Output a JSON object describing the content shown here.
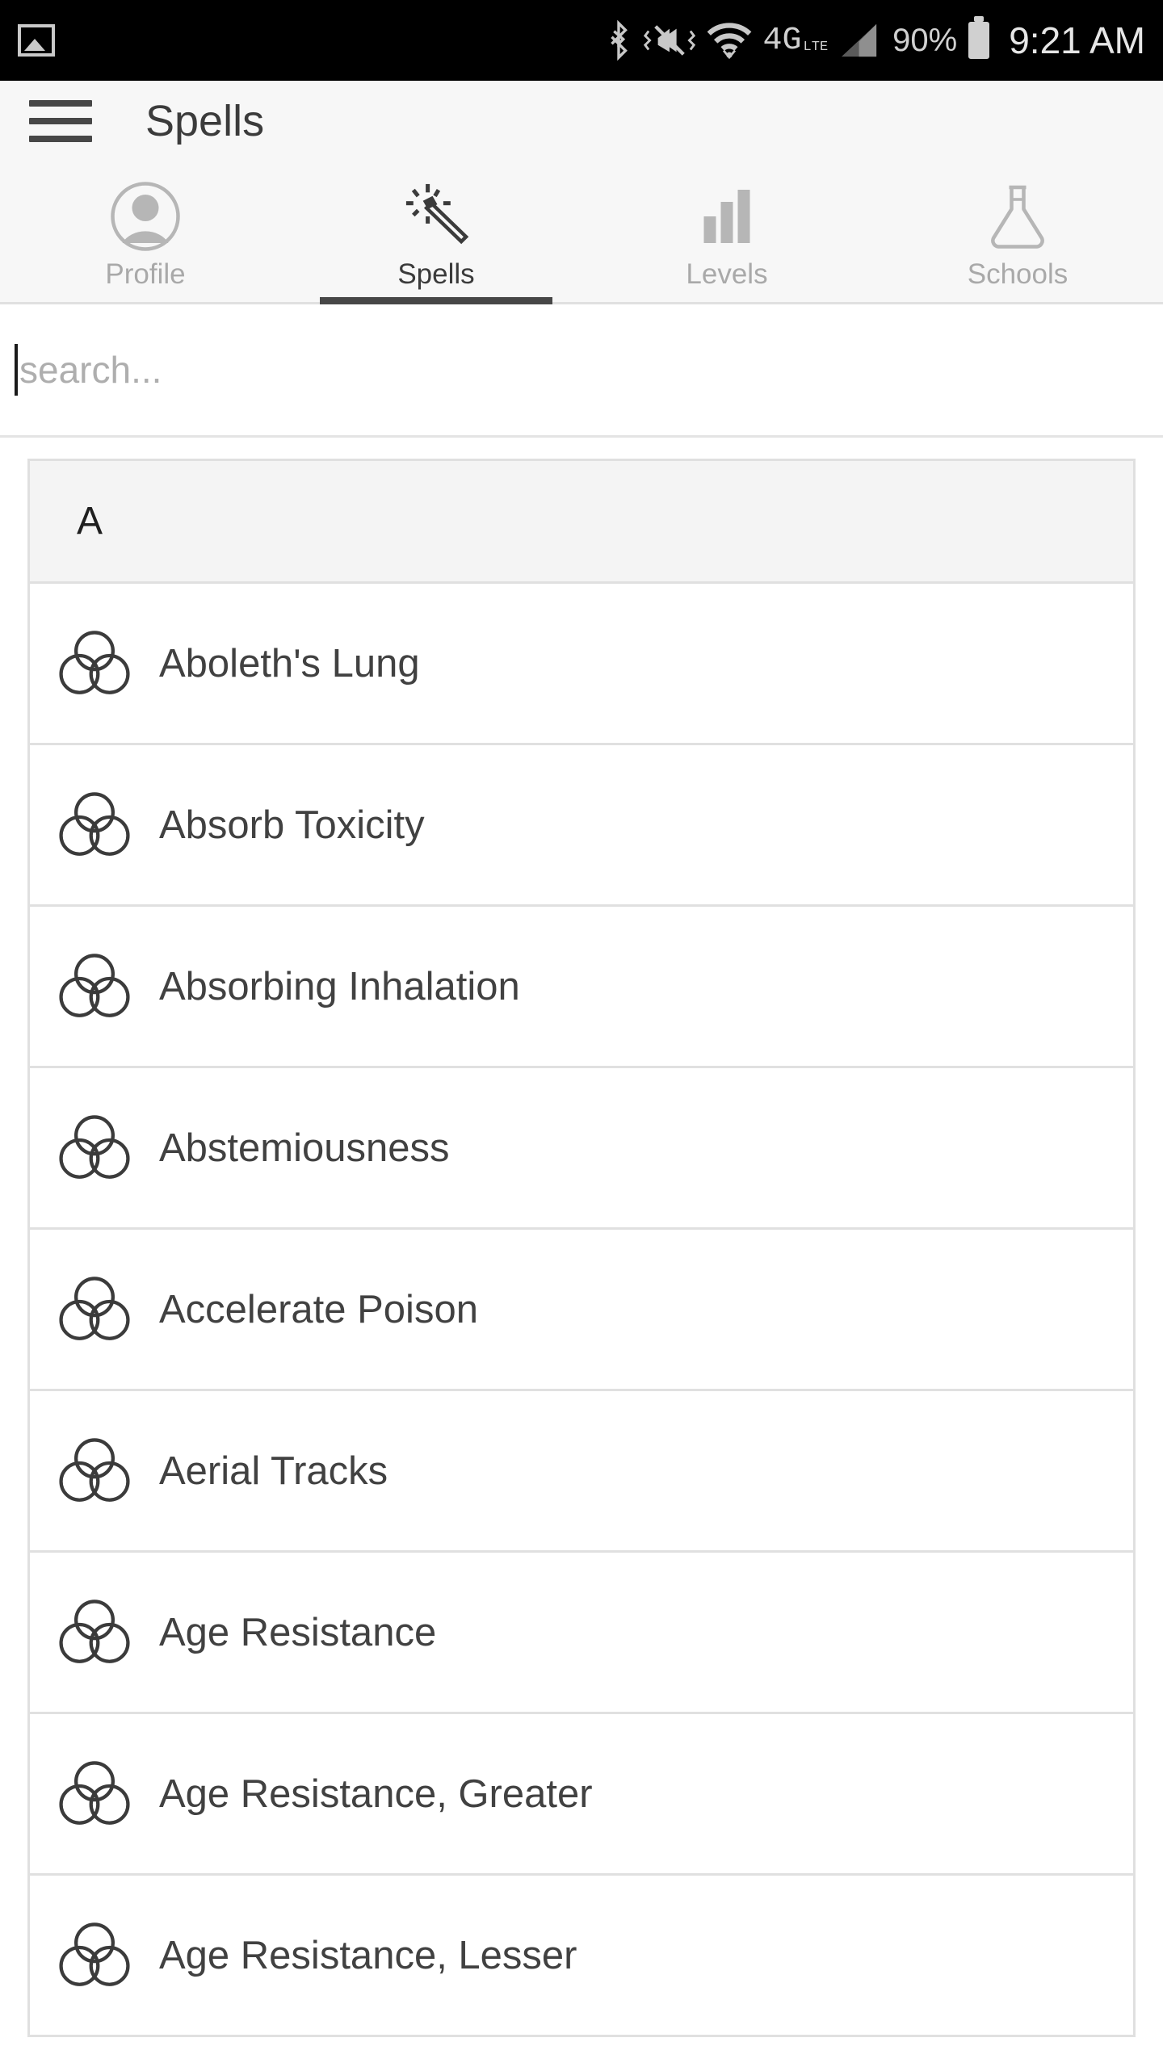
{
  "statusbar": {
    "gallery_icon": "gallery-icon",
    "bluetooth_icon": "bluetooth-icon",
    "vibrate_off_icon": "vibrate-off-icon",
    "wifi_icon": "wifi-icon",
    "network_type": "4G",
    "network_type_sub": "LTE",
    "signal_icon": "cellular-signal-icon",
    "battery_percent": "90%",
    "battery_icon": "battery-icon",
    "clock": "9:21 AM"
  },
  "appbar": {
    "menu_icon": "hamburger-menu-icon",
    "title": "Spells"
  },
  "tabs": [
    {
      "label": "Profile",
      "icon": "profile-avatar-icon",
      "active": false
    },
    {
      "label": "Spells",
      "icon": "magic-wand-icon",
      "active": true
    },
    {
      "label": "Levels",
      "icon": "bar-chart-icon",
      "active": false
    },
    {
      "label": "Schools",
      "icon": "flask-icon",
      "active": false
    }
  ],
  "search": {
    "value": "",
    "placeholder": "search..."
  },
  "list": {
    "sections": [
      {
        "letter": "A",
        "items": [
          {
            "name": "Aboleth's Lung",
            "icon": "three-circles-icon"
          },
          {
            "name": "Absorb Toxicity",
            "icon": "three-circles-icon"
          },
          {
            "name": "Absorbing Inhalation",
            "icon": "three-circles-icon"
          },
          {
            "name": "Abstemiousness",
            "icon": "three-circles-icon"
          },
          {
            "name": "Accelerate Poison",
            "icon": "three-circles-icon"
          },
          {
            "name": "Aerial Tracks",
            "icon": "three-circles-icon"
          },
          {
            "name": "Age Resistance",
            "icon": "three-circles-icon"
          },
          {
            "name": "Age Resistance, Greater",
            "icon": "three-circles-icon"
          },
          {
            "name": "Age Resistance, Lesser",
            "icon": "three-circles-icon"
          }
        ]
      }
    ]
  },
  "colors": {
    "statusbar_bg": "#000000",
    "appbar_bg": "#f7f7f7",
    "accent_underline": "#474747",
    "text_primary": "#3b3b3b",
    "text_muted": "#a9a9a9",
    "border": "#e0e0e0"
  }
}
